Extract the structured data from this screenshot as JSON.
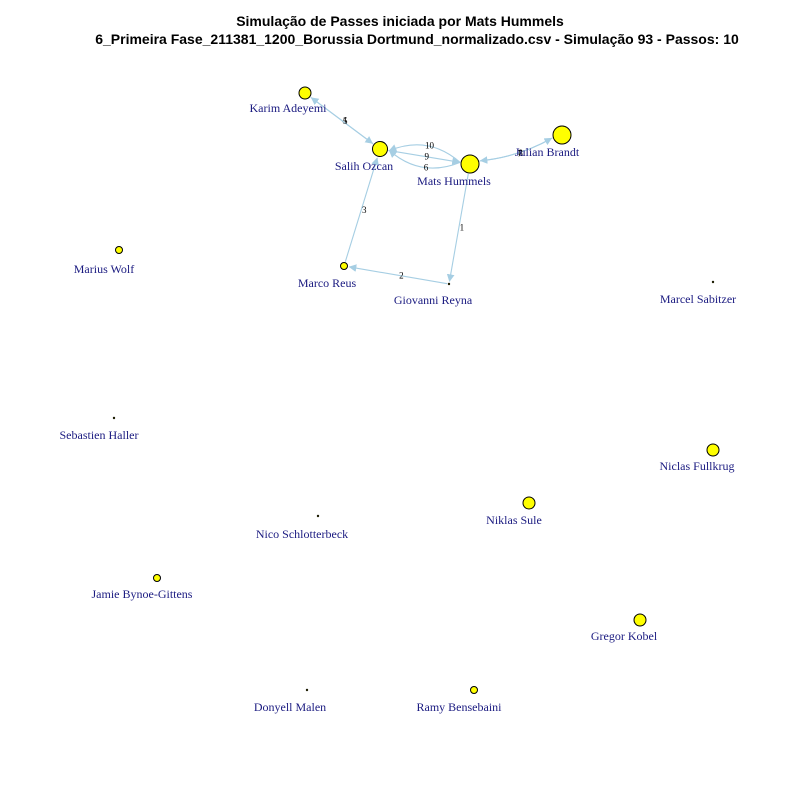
{
  "title": {
    "line1": "Simulação de Passes iniciada por Mats Hummels",
    "line2": "6_Primeira Fase_211381_1200_Borussia Dortmund_normalizado.csv - Simulação 93 - Passos: 10"
  },
  "colors": {
    "node_fill": "#ffff00",
    "node_stroke": "#000000",
    "edge": "#a6cee3",
    "label": "#1a1a80"
  },
  "nodes": [
    {
      "id": "karim",
      "name": "Karim Adeyemi",
      "size": 2
    },
    {
      "id": "salih",
      "name": "Salih Ozcan",
      "size": 3
    },
    {
      "id": "mats",
      "name": "Mats Hummels",
      "size": 4
    },
    {
      "id": "julian",
      "name": "Julian Brandt",
      "size": 4
    },
    {
      "id": "marius",
      "name": "Marius Wolf",
      "size": 1
    },
    {
      "id": "marco",
      "name": "Marco Reus",
      "size": 1
    },
    {
      "id": "giovanni",
      "name": "Giovanni Reyna",
      "size": 0
    },
    {
      "id": "marcel",
      "name": "Marcel Sabitzer",
      "size": 0
    },
    {
      "id": "sebastien",
      "name": "Sebastien Haller",
      "size": 0
    },
    {
      "id": "niclas_f",
      "name": "Niclas Fullkrug",
      "size": 2
    },
    {
      "id": "niklas_s",
      "name": "Niklas Sule",
      "size": 2
    },
    {
      "id": "nico",
      "name": "Nico Schlotterbeck",
      "size": 0
    },
    {
      "id": "jamie",
      "name": "Jamie Bynoe-Gittens",
      "size": 1
    },
    {
      "id": "gregor",
      "name": "Gregor Kobel",
      "size": 2
    },
    {
      "id": "donyell",
      "name": "Donyell Malen",
      "size": 0
    },
    {
      "id": "ramy",
      "name": "Ramy Bensebaini",
      "size": 1
    }
  ],
  "edges": [
    {
      "from": "mats",
      "to": "giovanni",
      "label": "1"
    },
    {
      "from": "giovanni",
      "to": "marco",
      "label": "2"
    },
    {
      "from": "marco",
      "to": "salih",
      "label": "3"
    },
    {
      "from": "karim",
      "to": "salih",
      "label": "4"
    },
    {
      "from": "salih",
      "to": "karim",
      "label": "5"
    },
    {
      "from": "mats",
      "to": "salih",
      "label": "6"
    },
    {
      "from": "mats",
      "to": "julian",
      "label": "7"
    },
    {
      "from": "julian",
      "to": "mats",
      "label": "8"
    },
    {
      "from": "salih",
      "to": "mats",
      "label": "9"
    },
    {
      "from": "mats",
      "to": "salih",
      "label": "10"
    }
  ]
}
